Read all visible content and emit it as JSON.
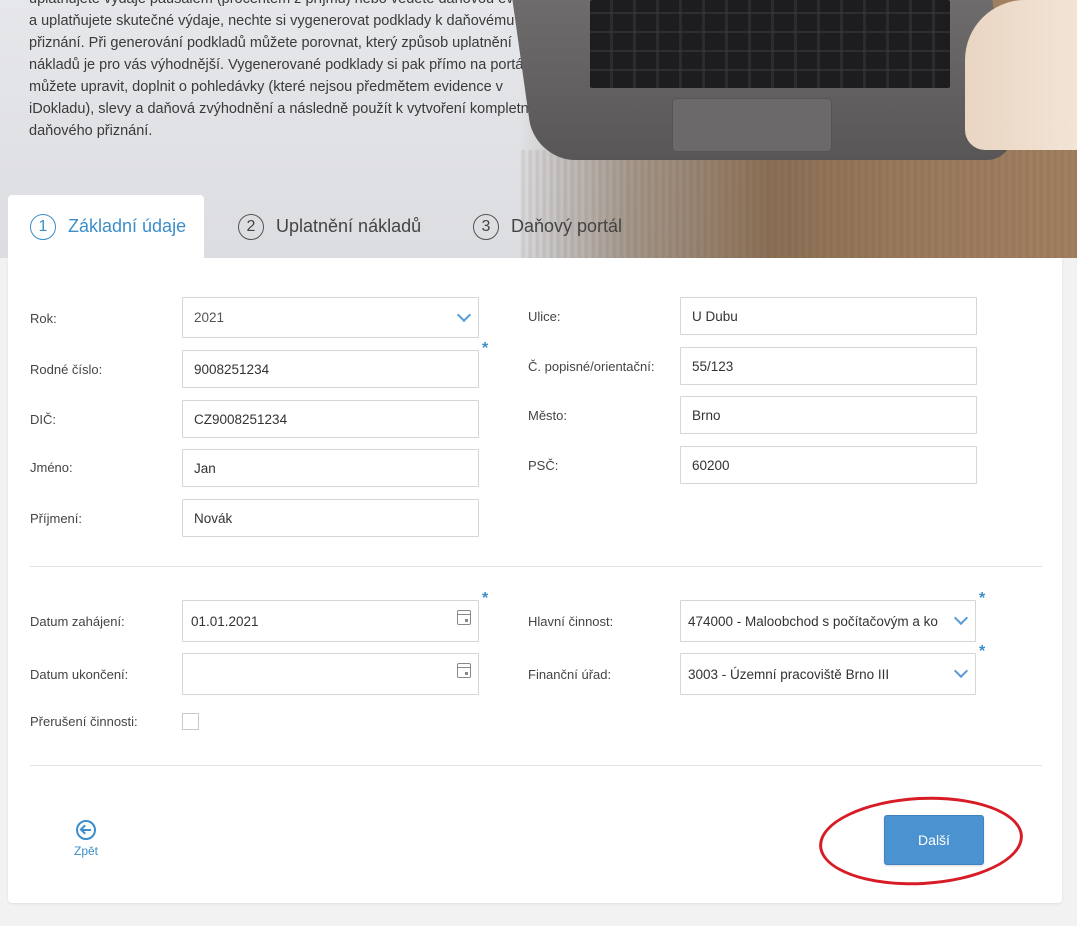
{
  "hero": {
    "intro_text": "uplatňujete výdaje paušálem (procentem z příjmů) nebo vedete daňovou evidenci a uplatňujete skutečné výdaje, nechte si vygenerovat podklady k daňovému přiznání. Při generování podkladů můžete porovnat, který způsob uplatnění nákladů je pro vás výhodnější. Vygenerované podklady si pak přímo na portálu můžete upravit, doplnit o pohledávky (které nejsou předmětem evidence v iDokladu), slevy a daňová zvýhodnění a následně použít k vytvoření kompletního daňového přiznání."
  },
  "tabs": [
    {
      "number": "1",
      "label": "Základní údaje",
      "active": true
    },
    {
      "number": "2",
      "label": "Uplatnění nákladů",
      "active": false
    },
    {
      "number": "3",
      "label": "Daňový portál",
      "active": false
    }
  ],
  "form": {
    "left": [
      {
        "label": "Rok:",
        "value": "2021",
        "type": "select"
      },
      {
        "label": "Rodné číslo:",
        "value": "9008251234",
        "required": true
      },
      {
        "label": "DIČ:",
        "value": "CZ9008251234"
      },
      {
        "label": "Jméno:",
        "value": "Jan"
      },
      {
        "label": "Příjmení:",
        "value": "Novák"
      }
    ],
    "right": [
      {
        "label": "Ulice:",
        "value": "U Dubu"
      },
      {
        "label": "Č. popisné/orientační:",
        "value": "55/123"
      },
      {
        "label": "Město:",
        "value": "Brno"
      },
      {
        "label": "PSČ:",
        "value": "60200"
      }
    ],
    "activity_left": [
      {
        "label": "Datum zahájení:",
        "value": "01.01.2021",
        "type": "date",
        "required": true
      },
      {
        "label": "Datum ukončení:",
        "value": "",
        "type": "date"
      },
      {
        "label": "Přerušení činnosti:",
        "type": "checkbox",
        "checked": false
      }
    ],
    "activity_right": [
      {
        "label": "Hlavní činnost:",
        "value": "474000 - Maloobchod s počítačovým a ko",
        "type": "select",
        "required": true
      },
      {
        "label": "Finanční úřad:",
        "value": "3003 - Územní pracoviště Brno III",
        "type": "select",
        "required": true
      }
    ],
    "required_mark": "*"
  },
  "footer": {
    "back_label": "Zpět",
    "next_label": "Další"
  },
  "colors": {
    "accent": "#3b8ec9",
    "button": "#4a92d0",
    "annotation": "#d71c25"
  }
}
